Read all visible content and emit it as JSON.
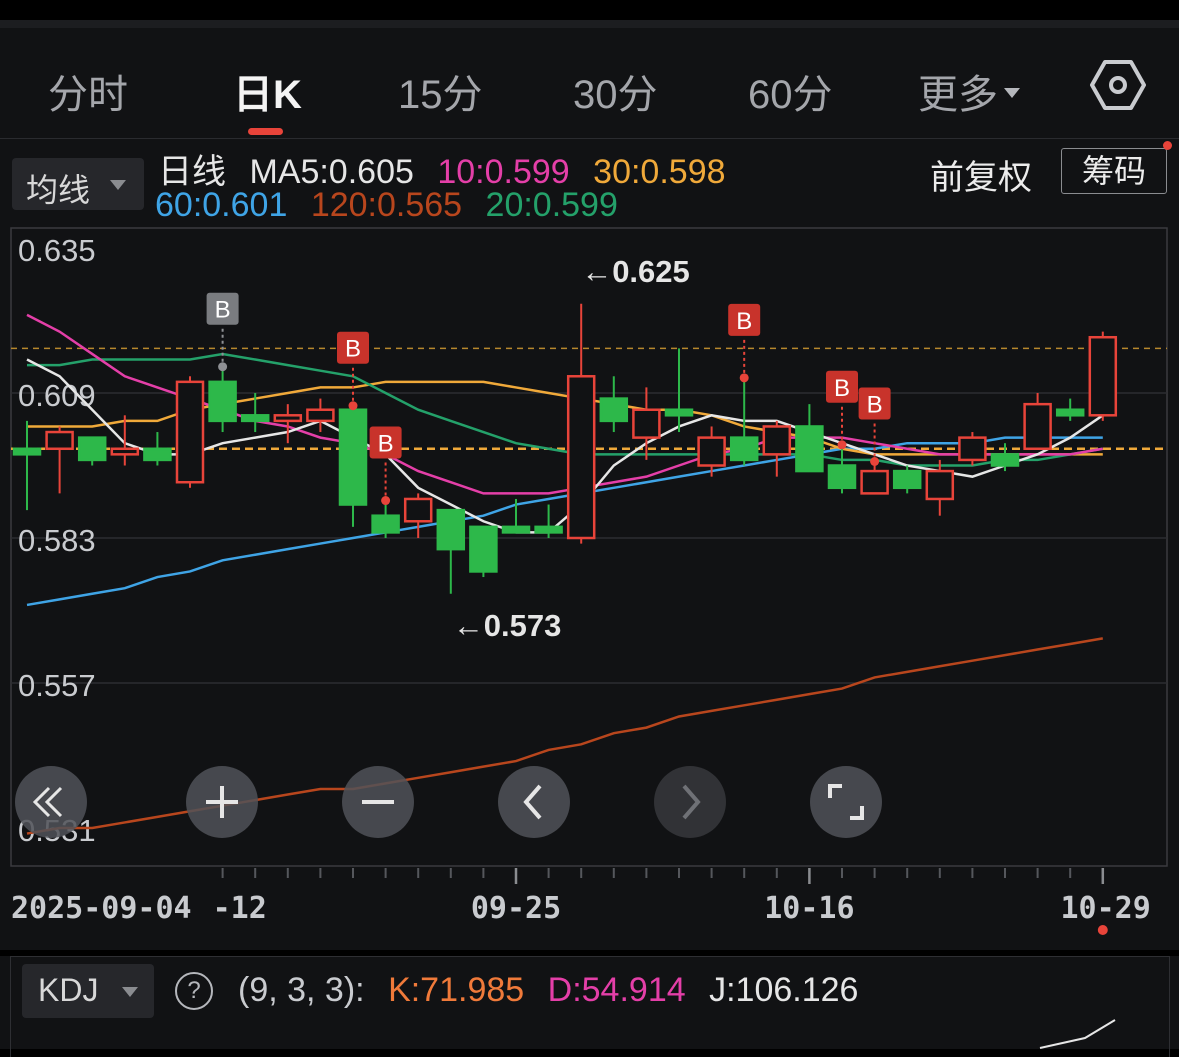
{
  "tabs": [
    {
      "label": "分时",
      "active": false
    },
    {
      "label": "日K",
      "active": true
    },
    {
      "label": "15分",
      "active": false
    },
    {
      "label": "30分",
      "active": false
    },
    {
      "label": "60分",
      "active": false
    },
    {
      "label": "更多",
      "active": false
    }
  ],
  "settings_icon": "hexagon-gear-icon",
  "indicator_select": {
    "label": "均线"
  },
  "ma_legend": {
    "line_label": "日线",
    "items": [
      {
        "text": "MA5:0.605",
        "color": "#e6e6e6"
      },
      {
        "text": "10:0.599",
        "color": "#e43fa8"
      },
      {
        "text": "30:0.598",
        "color": "#f0a93a"
      },
      {
        "text": "60:0.601",
        "color": "#3fa4e6"
      },
      {
        "text": "120:0.565",
        "color": "#b8461d"
      },
      {
        "text": "20:0.599",
        "color": "#24a16a"
      }
    ]
  },
  "adjust_label": "前复权",
  "chip_label": "筹码",
  "colors": {
    "up": "#e8443a",
    "down": "#2db84a",
    "ref_dash": "#f0a93a"
  },
  "chart_data": {
    "type": "candlestick",
    "y_ticks": [
      "0.635",
      "0.609",
      "0.583",
      "0.557",
      "0.531"
    ],
    "y_range": [
      0.531,
      0.635
    ],
    "x_labels": [
      "2025-09-04",
      "-12",
      "09-25",
      "10-16",
      "10-29"
    ],
    "high_marker": "←0.625",
    "low_marker": "←0.573",
    "ref_lines": [
      0.617,
      0.599
    ],
    "candles": [
      {
        "o": 0.599,
        "c": 0.598,
        "h": 0.604,
        "l": 0.588
      },
      {
        "o": 0.599,
        "c": 0.602,
        "h": 0.603,
        "l": 0.591
      },
      {
        "o": 0.601,
        "c": 0.597,
        "h": 0.601,
        "l": 0.596
      },
      {
        "o": 0.598,
        "c": 0.599,
        "h": 0.605,
        "l": 0.596
      },
      {
        "o": 0.599,
        "c": 0.597,
        "h": 0.602,
        "l": 0.596
      },
      {
        "o": 0.593,
        "c": 0.611,
        "h": 0.612,
        "l": 0.592
      },
      {
        "o": 0.611,
        "c": 0.604,
        "h": 0.613,
        "l": 0.602
      },
      {
        "o": 0.605,
        "c": 0.604,
        "h": 0.609,
        "l": 0.602
      },
      {
        "o": 0.604,
        "c": 0.605,
        "h": 0.607,
        "l": 0.6
      },
      {
        "o": 0.604,
        "c": 0.606,
        "h": 0.608,
        "l": 0.602
      },
      {
        "o": 0.606,
        "c": 0.589,
        "h": 0.606,
        "l": 0.585
      },
      {
        "o": 0.587,
        "c": 0.584,
        "h": 0.589,
        "l": 0.583
      },
      {
        "o": 0.586,
        "c": 0.59,
        "h": 0.591,
        "l": 0.583
      },
      {
        "o": 0.588,
        "c": 0.581,
        "h": 0.588,
        "l": 0.573
      },
      {
        "o": 0.585,
        "c": 0.577,
        "h": 0.585,
        "l": 0.576
      },
      {
        "o": 0.585,
        "c": 0.584,
        "h": 0.59,
        "l": 0.584
      },
      {
        "o": 0.585,
        "c": 0.584,
        "h": 0.589,
        "l": 0.583
      },
      {
        "o": 0.583,
        "c": 0.612,
        "h": 0.625,
        "l": 0.582
      },
      {
        "o": 0.608,
        "c": 0.604,
        "h": 0.612,
        "l": 0.602
      },
      {
        "o": 0.601,
        "c": 0.606,
        "h": 0.61,
        "l": 0.597
      },
      {
        "o": 0.606,
        "c": 0.605,
        "h": 0.617,
        "l": 0.602
      },
      {
        "o": 0.596,
        "c": 0.601,
        "h": 0.603,
        "l": 0.594
      },
      {
        "o": 0.601,
        "c": 0.597,
        "h": 0.611,
        "l": 0.596
      },
      {
        "o": 0.598,
        "c": 0.603,
        "h": 0.604,
        "l": 0.594
      },
      {
        "o": 0.603,
        "c": 0.595,
        "h": 0.607,
        "l": 0.595
      },
      {
        "o": 0.596,
        "c": 0.592,
        "h": 0.599,
        "l": 0.591
      },
      {
        "o": 0.591,
        "c": 0.595,
        "h": 0.596,
        "l": 0.591
      },
      {
        "o": 0.595,
        "c": 0.592,
        "h": 0.596,
        "l": 0.591
      },
      {
        "o": 0.59,
        "c": 0.595,
        "h": 0.597,
        "l": 0.587
      },
      {
        "o": 0.597,
        "c": 0.601,
        "h": 0.602,
        "l": 0.596
      },
      {
        "o": 0.598,
        "c": 0.596,
        "h": 0.6,
        "l": 0.595
      },
      {
        "o": 0.599,
        "c": 0.607,
        "h": 0.609,
        "l": 0.605
      },
      {
        "o": 0.606,
        "c": 0.605,
        "h": 0.608,
        "l": 0.604
      },
      {
        "o": 0.605,
        "c": 0.619,
        "h": 0.62,
        "l": 0.604
      }
    ],
    "b_signals": [
      {
        "index": 6,
        "color": "gray"
      },
      {
        "index": 10,
        "color": "red"
      },
      {
        "index": 11,
        "color": "red"
      },
      {
        "index": 22,
        "color": "red"
      },
      {
        "index": 25,
        "color": "red"
      },
      {
        "index": 26,
        "color": "red"
      }
    ],
    "ma_series": {
      "MA5": [
        0.615,
        0.612,
        0.606,
        0.6,
        0.598,
        0.598,
        0.6,
        0.601,
        0.602,
        0.604,
        0.601,
        0.598,
        0.592,
        0.589,
        0.586,
        0.584,
        0.584,
        0.589,
        0.596,
        0.6,
        0.603,
        0.605,
        0.604,
        0.604,
        0.602,
        0.6,
        0.598,
        0.596,
        0.595,
        0.594,
        0.596,
        0.598,
        0.601,
        0.605
      ],
      "MA10": [
        0.623,
        0.62,
        0.616,
        0.612,
        0.61,
        0.608,
        0.606,
        0.604,
        0.603,
        0.601,
        0.6,
        0.598,
        0.595,
        0.593,
        0.591,
        0.591,
        0.591,
        0.592,
        0.593,
        0.594,
        0.596,
        0.598,
        0.599,
        0.601,
        0.601,
        0.601,
        0.6,
        0.599,
        0.598,
        0.598,
        0.598,
        0.598,
        0.598,
        0.599
      ],
      "MA20": [
        0.614,
        0.614,
        0.615,
        0.615,
        0.615,
        0.615,
        0.616,
        0.615,
        0.614,
        0.613,
        0.612,
        0.609,
        0.606,
        0.604,
        0.602,
        0.6,
        0.599,
        0.598,
        0.598,
        0.598,
        0.598,
        0.598,
        0.598,
        0.598,
        0.598,
        0.597,
        0.597,
        0.596,
        0.596,
        0.596,
        0.597,
        0.597,
        0.598,
        0.599
      ],
      "MA30": [
        0.603,
        0.603,
        0.603,
        0.604,
        0.604,
        0.606,
        0.607,
        0.608,
        0.609,
        0.61,
        0.61,
        0.611,
        0.611,
        0.611,
        0.611,
        0.61,
        0.609,
        0.608,
        0.607,
        0.606,
        0.606,
        0.605,
        0.603,
        0.602,
        0.601,
        0.599,
        0.598,
        0.598,
        0.598,
        0.598,
        0.598,
        0.598,
        0.598,
        0.598
      ],
      "MA60": [
        0.571,
        0.572,
        0.573,
        0.574,
        0.576,
        0.577,
        0.579,
        0.58,
        0.581,
        0.582,
        0.583,
        0.584,
        0.585,
        0.586,
        0.587,
        0.589,
        0.59,
        0.591,
        0.592,
        0.593,
        0.594,
        0.595,
        0.596,
        0.597,
        0.598,
        0.599,
        0.599,
        0.6,
        0.6,
        0.6,
        0.601,
        0.601,
        0.601,
        0.601
      ],
      "MA120": [
        0.53,
        0.531,
        0.531,
        0.532,
        0.533,
        0.534,
        0.535,
        0.536,
        0.537,
        0.538,
        0.538,
        0.539,
        0.54,
        0.541,
        0.542,
        0.543,
        0.545,
        0.546,
        0.548,
        0.549,
        0.551,
        0.552,
        0.553,
        0.554,
        0.555,
        0.556,
        0.558,
        0.559,
        0.56,
        0.561,
        0.562,
        0.563,
        0.564,
        0.565
      ]
    }
  },
  "nav_buttons": [
    "rewind-icon",
    "zoom-in-icon",
    "zoom-out-icon",
    "prev-icon",
    "next-icon",
    "fullscreen-icon"
  ],
  "kdj": {
    "select_label": "KDJ",
    "params": "(9, 3, 3):",
    "k": "K:71.985",
    "d": "D:54.914",
    "j": "J:106.126"
  }
}
